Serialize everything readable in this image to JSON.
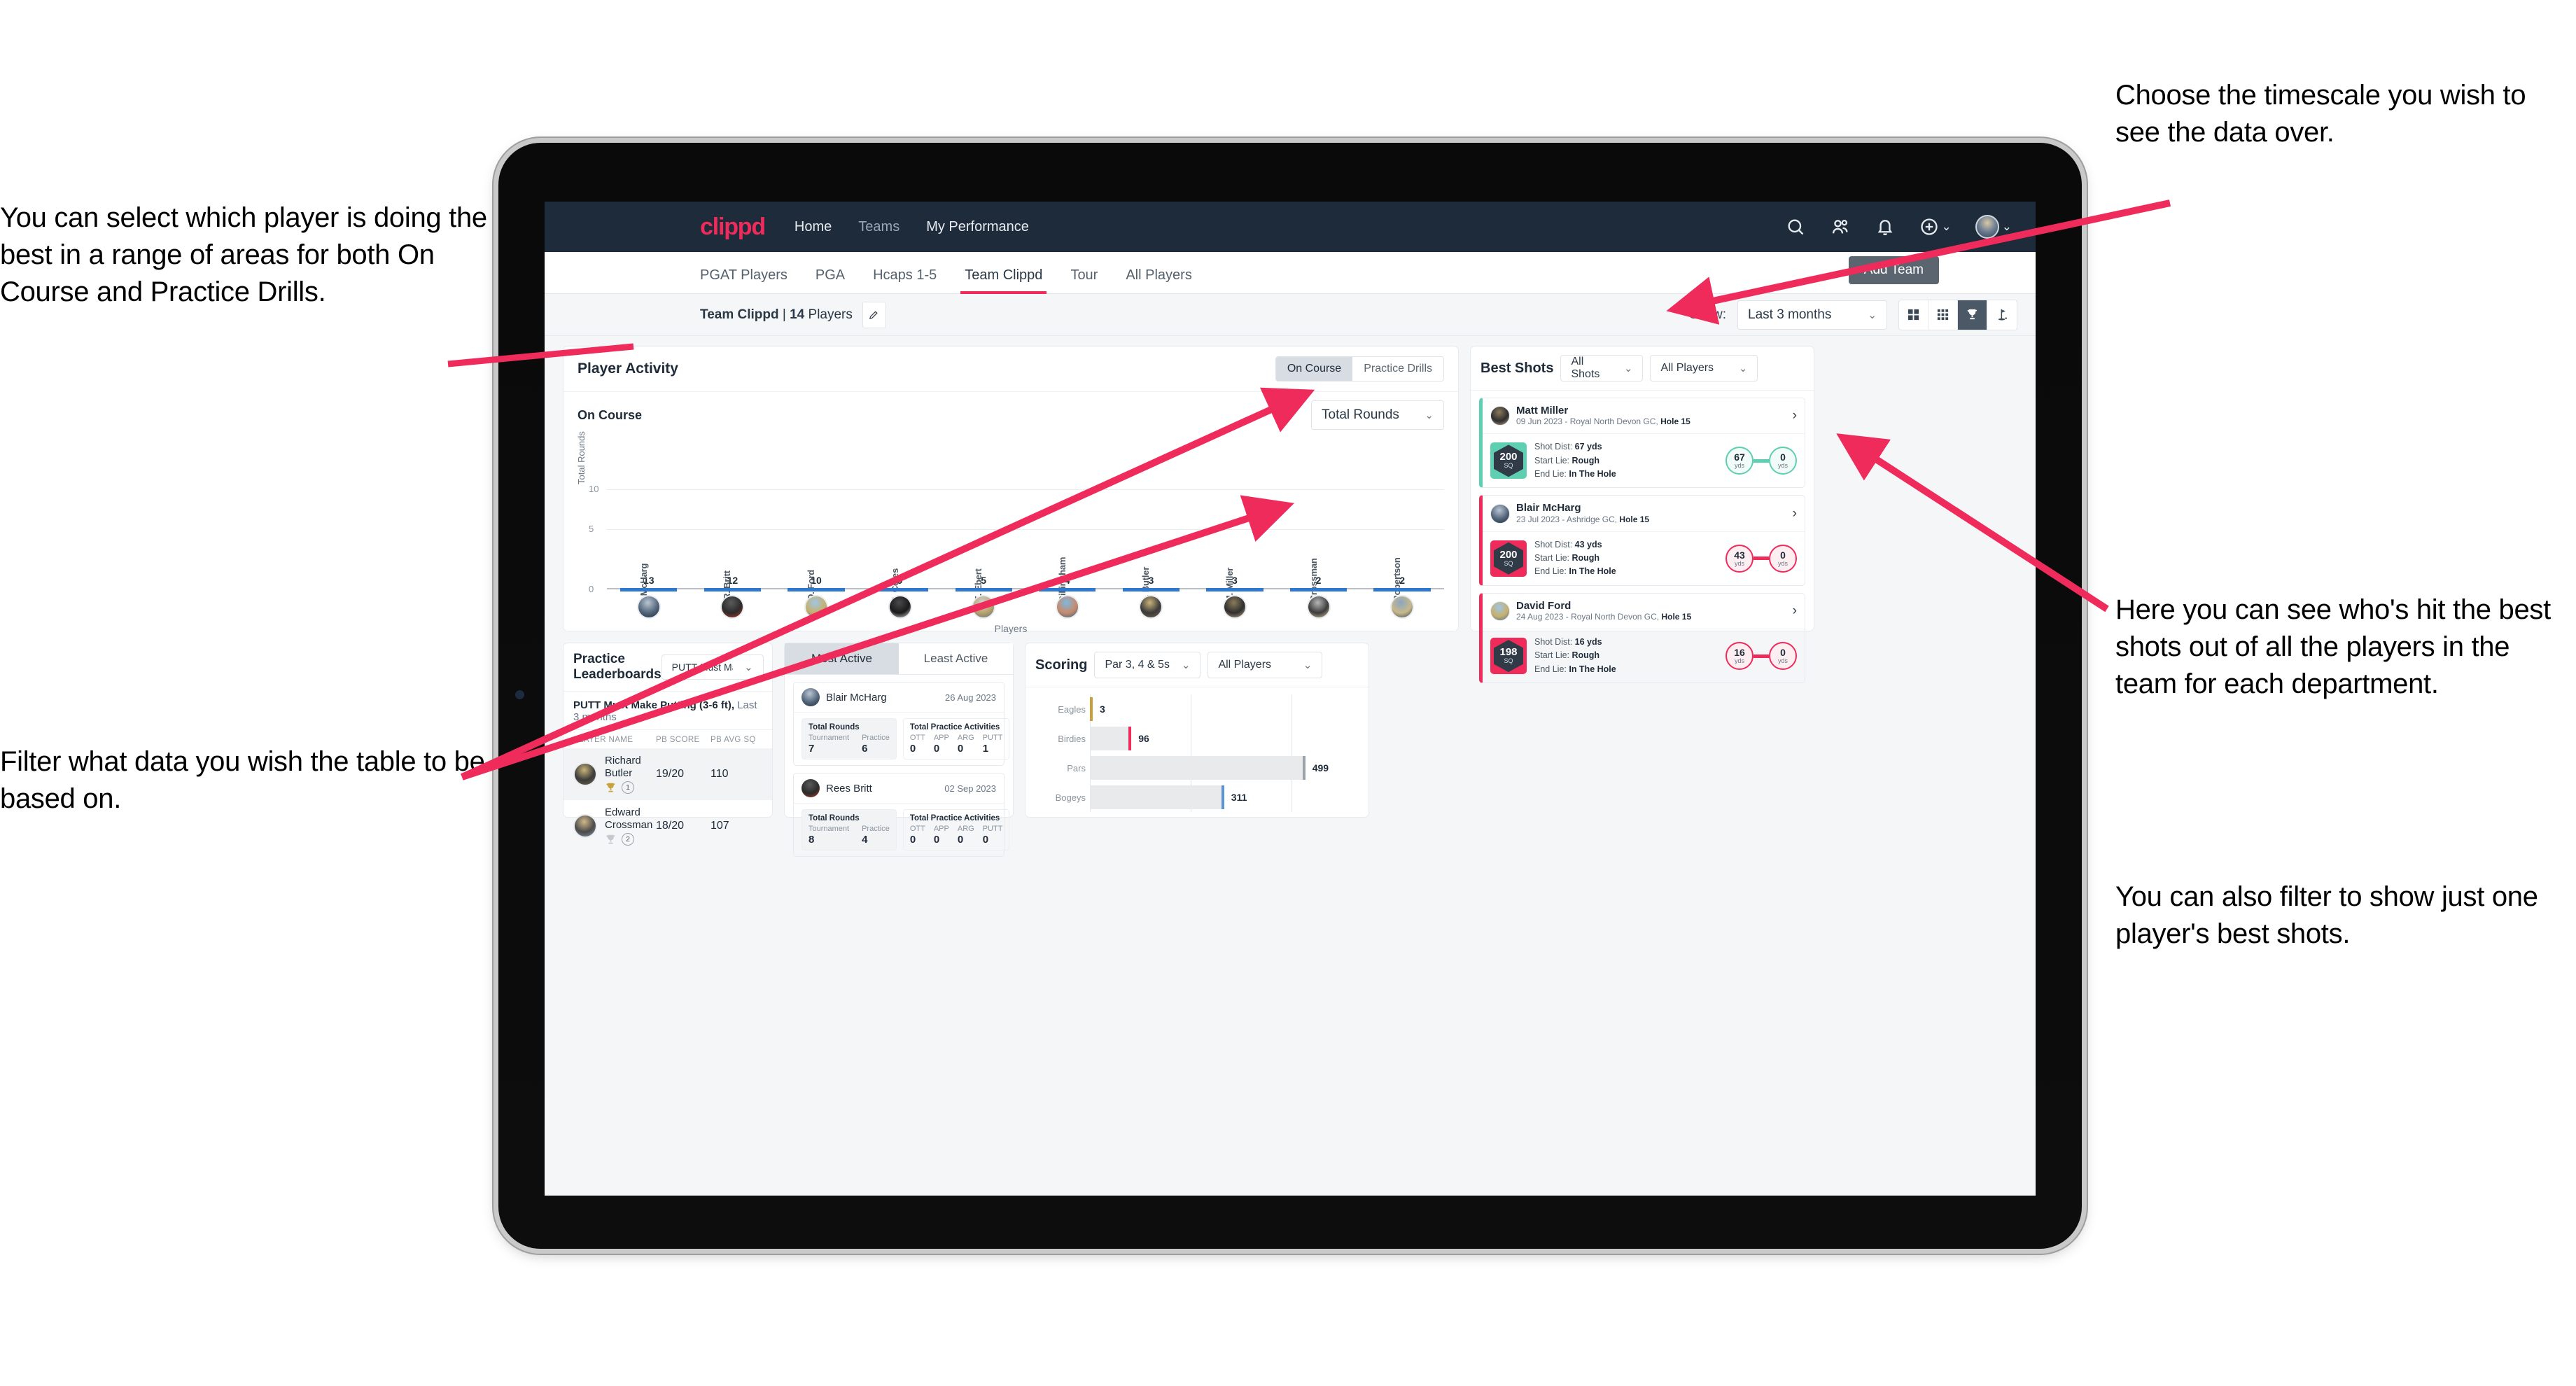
{
  "annotations": {
    "left_top": "You can select which player is doing the best in a range of areas for both On Course and Practice Drills.",
    "left_bottom": "Filter what data you wish the table to be based on.",
    "right_top": "Choose the timescale you wish to see the data over.",
    "right_mid": "Here you can see who's hit the best shots out of all the players in the team for each department.",
    "right_bottom": "You can also filter to show just one player's best shots."
  },
  "topbar": {
    "logo": "clippd",
    "nav": [
      "Home",
      "Teams",
      "My Performance"
    ],
    "icons": [
      "search-icon",
      "people-icon",
      "bell-icon",
      "plus-circle-icon",
      "avatar"
    ]
  },
  "tabs": {
    "items": [
      "PGAT Players",
      "PGA",
      "Hcaps 1-5",
      "Team Clippd",
      "Tour",
      "All Players"
    ],
    "active": "Team Clippd",
    "add_team_label": "Add Team"
  },
  "subbar": {
    "team_name": "Team Clippd",
    "separator": " | ",
    "player_count": "14",
    "players_word": " Players",
    "show_label": "Show:",
    "timescale": "Last 3 months",
    "view_icons": [
      "grid-2x2-icon",
      "grid-3x3-icon",
      "trophy-icon",
      "golf-flag-icon"
    ],
    "view_active_index": 2
  },
  "player_activity": {
    "title": "Player Activity",
    "segments": [
      "On Course",
      "Practice Drills"
    ],
    "segment_active": "On Course",
    "sub_label": "On Course",
    "metric_select": "Total Rounds"
  },
  "chart_data": [
    {
      "type": "bar",
      "title": "Player Activity - On Course",
      "categories": [
        "B. McHarg",
        "R. Britt",
        "D. Ford",
        "J. Coles",
        "E. Ebert",
        "D. Billingham",
        "R. Butler",
        "M. Miller",
        "E. Crossman",
        "C. Robertson"
      ],
      "values": [
        13,
        12,
        10,
        9,
        5,
        4,
        3,
        3,
        2,
        2
      ],
      "xlabel": "Players",
      "ylabel": "Total Rounds",
      "yticks": [
        0,
        5,
        10
      ],
      "ylim": [
        0,
        14
      ],
      "grid": true
    },
    {
      "type": "bar",
      "title": "Scoring",
      "orientation": "horizontal",
      "categories": [
        "Eagles",
        "Birdies",
        "Pars",
        "Bogeys"
      ],
      "values": [
        3,
        96,
        499,
        311
      ],
      "colors": [
        "#c9a13b",
        "#ef2b5b",
        "#9aa3ab",
        "#5b93d6"
      ],
      "xlim": [
        0,
        600
      ],
      "grid": true
    }
  ],
  "best_shots": {
    "title": "Best Shots",
    "shot_filter": "All Shots",
    "player_filter": "All Players",
    "cards": [
      {
        "name": "Matt Miller",
        "meta_prefix": "09 Jun 2023 - Royal North Devon GC, ",
        "meta_hole": "Hole 15",
        "hex_value": "200",
        "hex_unit": "SQ",
        "accent": "#5ecfb1",
        "shot_dist_label": "Shot Dist: ",
        "shot_dist": "67 yds",
        "start_lie_label": "Start Lie: ",
        "start_lie": "Rough",
        "end_lie_label": "End Lie: ",
        "end_lie": "In The Hole",
        "from_value": "67",
        "from_unit": "yds",
        "to_value": "0",
        "to_unit": "yds"
      },
      {
        "name": "Blair McHarg",
        "meta_prefix": "23 Jul 2023 - Ashridge GC, ",
        "meta_hole": "Hole 15",
        "hex_value": "200",
        "hex_unit": "SQ",
        "accent": "#ef2b5b",
        "shot_dist_label": "Shot Dist: ",
        "shot_dist": "43 yds",
        "start_lie_label": "Start Lie: ",
        "start_lie": "Rough",
        "end_lie_label": "End Lie: ",
        "end_lie": "In The Hole",
        "from_value": "43",
        "from_unit": "yds",
        "to_value": "0",
        "to_unit": "yds"
      },
      {
        "name": "David Ford",
        "meta_prefix": "24 Aug 2023 - Royal North Devon GC, ",
        "meta_hole": "Hole 15",
        "hex_value": "198",
        "hex_unit": "SQ",
        "accent": "#ef2b5b",
        "shot_dist_label": "Shot Dist: ",
        "shot_dist": "16 yds",
        "start_lie_label": "Start Lie: ",
        "start_lie": "Rough",
        "end_lie_label": "End Lie: ",
        "end_lie": "In The Hole",
        "from_value": "16",
        "from_unit": "yds",
        "to_value": "0",
        "to_unit": "yds"
      }
    ]
  },
  "practice_leaderboards": {
    "title": "Practice Leaderboards",
    "drill_select": "PUTT Must Make Putting ...",
    "subtitle_bold": "PUTT Must Make Putting (3-6 ft),",
    "subtitle_rest": " Last 3 months",
    "columns": [
      "PLAYER NAME",
      "PB SCORE",
      "PB AVG SQ"
    ],
    "rows": [
      {
        "name": "Richard Butler",
        "rank": "1",
        "pb_score": "19/20",
        "pb_avg_sq": "110",
        "trophy": "gold"
      },
      {
        "name": "Edward Crossman",
        "rank": "2",
        "pb_score": "18/20",
        "pb_avg_sq": "107",
        "trophy": "silver"
      }
    ]
  },
  "activity": {
    "tabs": [
      "Most Active",
      "Least Active"
    ],
    "active_tab": "Most Active",
    "cards": [
      {
        "name": "Blair McHarg",
        "date": "26 Aug 2023",
        "rounds_title": "Total Rounds",
        "rounds_keys": [
          "Tournament",
          "Practice"
        ],
        "rounds_values": [
          "7",
          "6"
        ],
        "practice_title": "Total Practice Activities",
        "practice_keys": [
          "OTT",
          "APP",
          "ARG",
          "PUTT"
        ],
        "practice_values": [
          "0",
          "0",
          "0",
          "1"
        ]
      },
      {
        "name": "Rees Britt",
        "date": "02 Sep 2023",
        "rounds_title": "Total Rounds",
        "rounds_keys": [
          "Tournament",
          "Practice"
        ],
        "rounds_values": [
          "8",
          "4"
        ],
        "practice_title": "Total Practice Activities",
        "practice_keys": [
          "OTT",
          "APP",
          "ARG",
          "PUTT"
        ],
        "practice_values": [
          "0",
          "0",
          "0",
          "0"
        ]
      }
    ]
  },
  "scoring": {
    "title": "Scoring",
    "par_filter": "Par 3, 4 & 5s",
    "player_filter": "All Players",
    "rows": [
      {
        "label": "Eagles",
        "value": "3"
      },
      {
        "label": "Birdies",
        "value": "96"
      },
      {
        "label": "Pars",
        "value": "499"
      },
      {
        "label": "Bogeys",
        "value": "311"
      }
    ]
  },
  "colors": {
    "brand": "#ef2b5b",
    "navy": "#1d2b3a",
    "teal": "#5ecfb1",
    "blue": "#2f78d0"
  }
}
